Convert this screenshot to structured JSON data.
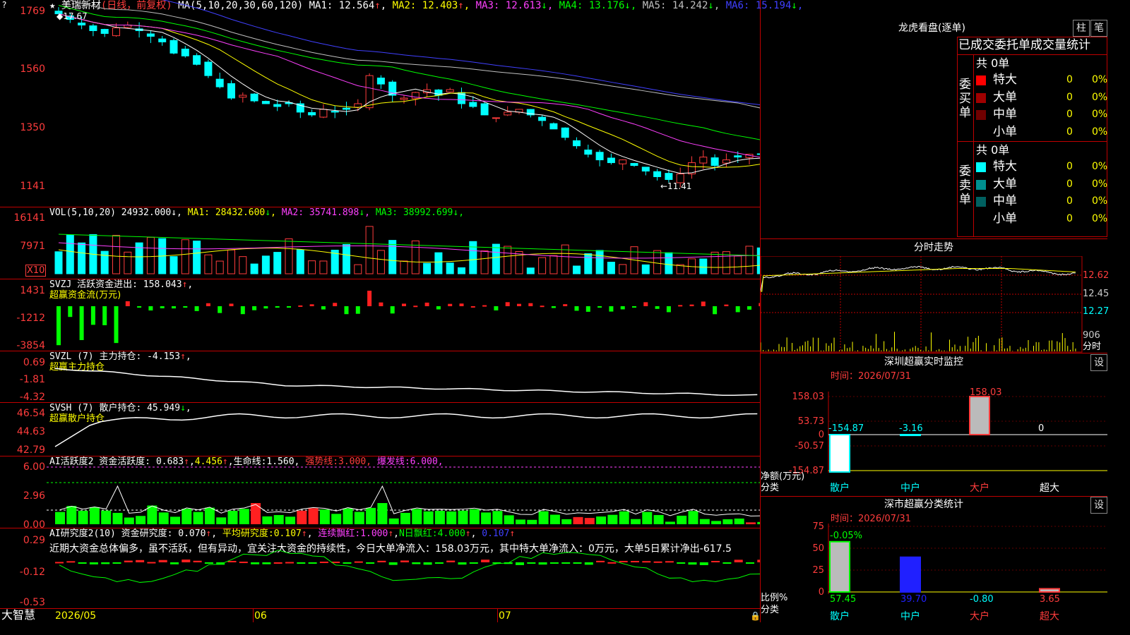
{
  "stock": {
    "name": "美瑞新材",
    "mode": "(日线，前复权)",
    "ma_label": "MA(5,10,20,30,60,120)",
    "ma": [
      {
        "label": "MA1:",
        "value": "12.564",
        "arrow": "↑",
        "color": "#ffffff"
      },
      {
        "label": "MA2:",
        "value": "12.403",
        "arrow": "↑",
        "color": "#ffff00"
      },
      {
        "label": "MA3:",
        "value": "12.613",
        "arrow": "↓",
        "color": "#ff40ff"
      },
      {
        "label": "MA4:",
        "value": "13.176",
        "arrow": "↓",
        "color": "#00ff00"
      },
      {
        "label": "MA5:",
        "value": "14.242",
        "arrow": "↓",
        "color": "#c0c0c0"
      },
      {
        "label": "MA6:",
        "value": "15.194",
        "arrow": "↓",
        "color": "#4040ff"
      }
    ],
    "high_label": "17.67",
    "low_label": "←11.41",
    "price_ticks": [
      "1769",
      "1560",
      "1350",
      "1141"
    ]
  },
  "vol": {
    "header": "VOL(5,10,20)",
    "value": "24932.000",
    "ma": [
      {
        "label": "MA1:",
        "value": "28432.600",
        "arrow": "↓",
        "color": "#ffff00"
      },
      {
        "label": "MA2:",
        "value": "35741.898",
        "arrow": "↓",
        "color": "#ff40ff"
      },
      {
        "label": "MA3:",
        "value": "38992.699",
        "arrow": "↓",
        "color": "#00ff00"
      }
    ],
    "ticks": [
      "16141",
      "7971"
    ],
    "unit": "X10"
  },
  "svzj": {
    "header": "SVZJ  活跃资金进出:",
    "value": "158.043",
    "arrow": "↑",
    "title": "超赢资金流(万元)",
    "ticks": [
      "1431",
      "-1212",
      "-3854"
    ]
  },
  "svzl": {
    "header": "SVZL (7) 主力持仓:",
    "value": "-4.153",
    "arrow": "↑",
    "title": "超赢主力持仓",
    "ticks": [
      "0.69",
      "-1.81",
      "-4.32"
    ]
  },
  "svsh": {
    "header": "SVSH (7) 散户持仓:",
    "value": "45.949",
    "arrow": "↓",
    "title": "超赢散户持仓",
    "ticks": [
      "46.54",
      "44.63",
      "42.79"
    ]
  },
  "ai_active": {
    "header": "AI活跃度2 资金活跃度:",
    "v1": "0.683",
    "v2": "4.456",
    "life_label": "生命线:",
    "life": "1.560",
    "strong_label": "强势线:",
    "strong": "3.000",
    "burst_label": "爆发线:",
    "burst": "6.000",
    "ticks": [
      "6.00",
      "2.96",
      "0.00"
    ]
  },
  "ai_research": {
    "header": "AI研究度2(10) 资金研究度:",
    "v1": "0.070",
    "avg_label": "平均研究度:",
    "avg": "0.107",
    "lianxu_label": "连续飘红:",
    "lianxu": "1.000",
    "nday_label": "N日飘红:",
    "nday": "4.000",
    "last": "0.107",
    "comment": "近期大资金总体偏多，虽不活跃，但有异动，宜关注大资金的持续性，今日大单净流入：158.03万元，其中特大单净流入：0万元，大单5日累计净出-617.5",
    "ticks": [
      "0.29",
      "-0.12",
      "-0.53"
    ]
  },
  "footer": {
    "brand": "大智慧",
    "dates": [
      "2026/05",
      "06",
      "07"
    ]
  },
  "lhb": {
    "title": "龙虎看盘(逐单)",
    "btn1": "柱",
    "btn2": "笔",
    "tabs": "已成交委托单成交量统计",
    "buy_label": "委买单",
    "sell_label": "委卖单",
    "buy_total": "共 0单",
    "sell_total": "共 0单",
    "buy_rows": [
      {
        "name": "特大",
        "count": "0",
        "pct": "0%",
        "color": "#ff0000"
      },
      {
        "name": "大单",
        "count": "0",
        "pct": "0%",
        "color": "#a00000"
      },
      {
        "name": "中单",
        "count": "0",
        "pct": "0%",
        "color": "#700000"
      },
      {
        "name": "小单",
        "count": "0",
        "pct": "0%",
        "color": "#000000"
      }
    ],
    "sell_rows": [
      {
        "name": "特大",
        "count": "0",
        "pct": "0%",
        "color": "#00ffff"
      },
      {
        "name": "大单",
        "count": "0",
        "pct": "0%",
        "color": "#009090"
      },
      {
        "name": "中单",
        "count": "0",
        "pct": "0%",
        "color": "#006060"
      },
      {
        "name": "小单",
        "count": "0",
        "pct": "0%",
        "color": "#000000"
      }
    ]
  },
  "intraday": {
    "title": "分时走势",
    "ticks": [
      "12.62",
      "12.45",
      "12.27",
      "906"
    ],
    "unit": "分时"
  },
  "monitor": {
    "title": "深圳超赢实时监控",
    "btn": "设",
    "time_label": "时间：",
    "time": "2026/07/31",
    "ylabel": "净额(万元)",
    "xlabel": "分类",
    "ticks": [
      "158.03",
      "53.73",
      "0",
      "-50.57",
      "-154.87"
    ],
    "categories": [
      "散户",
      "中户",
      "大户",
      "超大"
    ],
    "values": [
      "-154.87",
      "-3.16",
      "158.03",
      "0"
    ]
  },
  "classify": {
    "title": "深市超赢分类统计",
    "btn": "设",
    "time_label": "时间：",
    "time": "2026/07/31",
    "ylabel": "比例%",
    "xlabel": "分类",
    "ticks": [
      "75",
      "50",
      "25",
      "0"
    ],
    "categories": [
      "散户",
      "中户",
      "大户",
      "超大"
    ],
    "values": [
      "57.45",
      "39.70",
      "-0.80",
      "3.65"
    ],
    "delta": "-0.05%"
  }
}
